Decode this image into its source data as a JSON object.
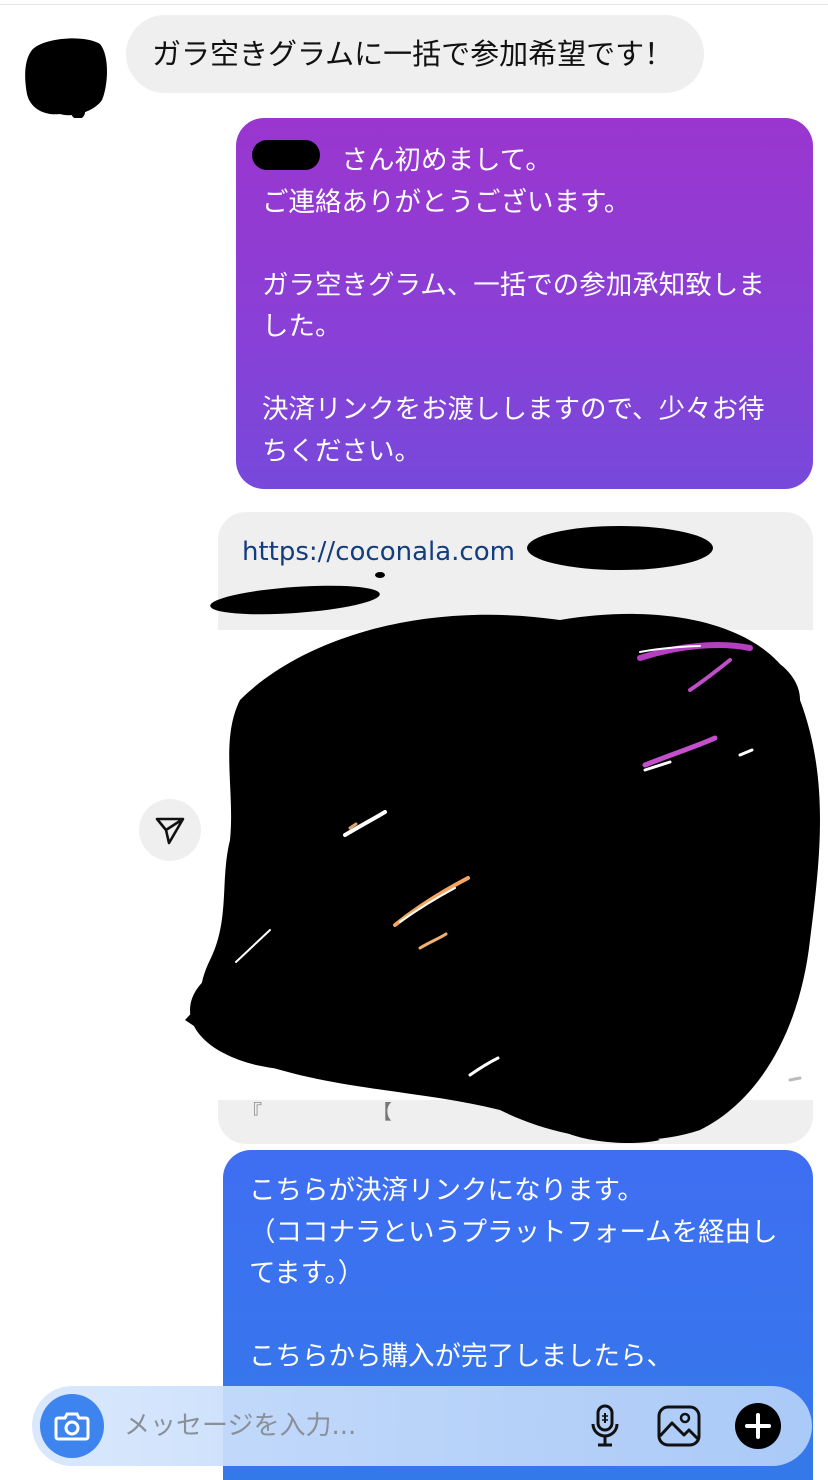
{
  "messages": {
    "incoming_1": "ガラ空きグラムに一括で参加希望です！",
    "outgoing_1": "　　　さん初めまして。\nご連絡ありがとうございます。\n\nガラ空きグラム、一括での参加承知致しました。\n\n決済リンクをお渡ししますので、少々お待ちください。",
    "link_url": "https://coconala.com",
    "link_caption": "『　　　　　　【　　　　　　　　、副...",
    "outgoing_2": "こちらが決済リンクになります。\n（ココナラというプラットフォームを経由してます。）\n\nこちらから購入が完了しましたら、"
  },
  "composer": {
    "placeholder": "メッセージを入力..."
  },
  "icons": {
    "share": "send-icon",
    "camera": "camera-icon",
    "mic": "microphone-icon",
    "gallery": "image-icon",
    "add": "plus-icon"
  },
  "colors": {
    "outgoing_purple": "#8a3fd6",
    "outgoing_blue": "#3479ea",
    "incoming_gray": "#efefef",
    "link_text": "#123d7e",
    "camera_button": "#3d84ee"
  }
}
